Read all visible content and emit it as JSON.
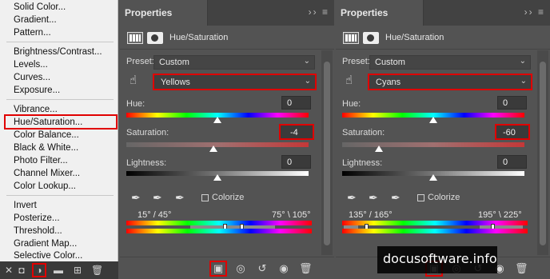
{
  "menu": {
    "items": [
      {
        "label": "Solid Color..."
      },
      {
        "label": "Gradient..."
      },
      {
        "label": "Pattern..."
      },
      {
        "label": "Brightness/Contrast..."
      },
      {
        "label": "Levels..."
      },
      {
        "label": "Curves..."
      },
      {
        "label": "Exposure..."
      },
      {
        "label": "Vibrance..."
      },
      {
        "label": "Hue/Saturation..."
      },
      {
        "label": "Color Balance..."
      },
      {
        "label": "Black & White..."
      },
      {
        "label": "Photo Filter..."
      },
      {
        "label": "Channel Mixer..."
      },
      {
        "label": "Color Lookup..."
      },
      {
        "label": "Invert"
      },
      {
        "label": "Posterize..."
      },
      {
        "label": "Threshold..."
      },
      {
        "label": "Gradient Map..."
      },
      {
        "label": "Selective Color..."
      }
    ],
    "highlighted": "Hue/Saturation..."
  },
  "panels": [
    {
      "tab": "Properties",
      "title": "Hue/Saturation",
      "preset_label": "Preset:",
      "preset_value": "Custom",
      "channel": "Yellows",
      "hue_label": "Hue:",
      "hue_value": "0",
      "hue_level": 0.5,
      "saturation_label": "Saturation:",
      "saturation_value": "-4",
      "saturation_level": 0.48,
      "lightness_label": "Lightness:",
      "lightness_value": "0",
      "lightness_level": 0.5,
      "colorize_label": "Colorize",
      "range_left": "15° / 45°",
      "range_right": "75° \\ 105°"
    },
    {
      "tab": "Properties",
      "title": "Hue/Saturation",
      "preset_label": "Preset:",
      "preset_value": "Custom",
      "channel": "Cyans",
      "hue_label": "Hue:",
      "hue_value": "0",
      "hue_level": 0.5,
      "saturation_label": "Saturation:",
      "saturation_value": "-60",
      "saturation_level": 0.2,
      "lightness_label": "Lightness:",
      "lightness_value": "0",
      "lightness_level": 0.5,
      "colorize_label": "Colorize",
      "range_left": "135° / 165°",
      "range_right": "195° \\ 225°"
    }
  ],
  "watermark": "docusoftware.info",
  "colors": {
    "highlight_red": "#e00000",
    "panel_bg": "#535353",
    "menu_bg": "#f0f0f0"
  }
}
